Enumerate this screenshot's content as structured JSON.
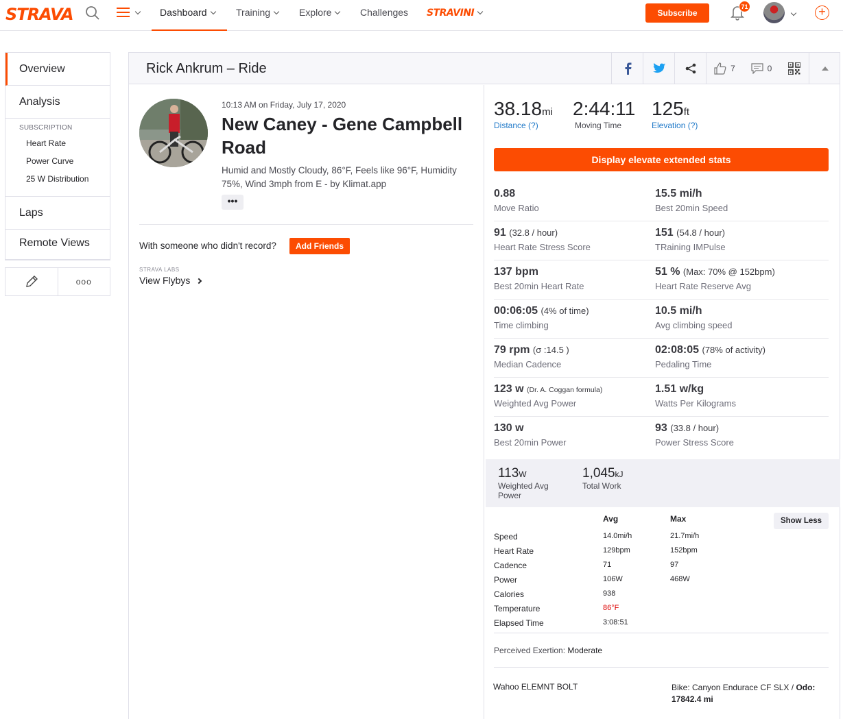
{
  "nav": {
    "logo": "STRAVA",
    "dashboard": "Dashboard",
    "training": "Training",
    "explore": "Explore",
    "challenges": "Challenges",
    "stravini": "STRAVINI",
    "subscribe": "Subscribe",
    "notifications": "71",
    "accent": "#fc4c02"
  },
  "sidebar": {
    "overview": "Overview",
    "analysis": "Analysis",
    "subscription_header": "SUBSCRIPTION",
    "sub_items": [
      "Heart Rate",
      "Power Curve",
      "25 W Distribution"
    ],
    "laps": "Laps",
    "remote_views": "Remote Views",
    "more": "ooo"
  },
  "header": {
    "title": "Rick Ankrum – Ride",
    "kudos": "7",
    "comments": "0"
  },
  "activity": {
    "date": "10:13 AM on Friday, July 17, 2020",
    "name": "New Caney - Gene Campbell Road",
    "description": "Humid and Mostly Cloudy, 86°F, Feels like 96°F, Humidity 75%, Wind 3mph from E - by Klimat.app",
    "more": "•••",
    "with_someone": "With someone who didn't record?",
    "add_friends": "Add Friends",
    "labs": "STRAVA LABS",
    "flybys": "View Flybys"
  },
  "big_stats": {
    "distance_val": "38.18",
    "distance_unit": "mi",
    "distance_lbl": "Distance (?)",
    "time_val": "2:44:11",
    "time_lbl": "Moving Time",
    "elev_val": "125",
    "elev_unit": "ft",
    "elev_lbl": "Elevation (?)"
  },
  "elevate_btn": "Display elevate extended stats",
  "extended": [
    [
      {
        "val": "0.88",
        "extra": "",
        "lbl": "Move Ratio"
      },
      {
        "val": "15.5 mi/h",
        "extra": "",
        "lbl": "Best 20min Speed"
      }
    ],
    [
      {
        "val": "91",
        "extra": "(32.8 / hour)",
        "lbl": "Heart Rate Stress Score"
      },
      {
        "val": "151",
        "extra": "(54.8 / hour)",
        "lbl": "TRaining IMPulse"
      }
    ],
    [
      {
        "val": "137 bpm",
        "extra": "",
        "lbl": "Best 20min Heart Rate"
      },
      {
        "val": "51 %",
        "extra": "(Max: 70% @ 152bpm)",
        "lbl": "Heart Rate Reserve Avg"
      }
    ],
    [
      {
        "val": "00:06:05",
        "extra": "(4% of time)",
        "lbl": "Time climbing"
      },
      {
        "val": "10.5 mi/h",
        "extra": "",
        "lbl": "Avg climbing speed"
      }
    ],
    [
      {
        "val": "79 rpm",
        "extra": "(σ :14.5 )",
        "lbl": "Median Cadence"
      },
      {
        "val": "02:08:05",
        "extra": "(78% of activity)",
        "lbl": "Pedaling Time"
      }
    ],
    [
      {
        "val": "123 w",
        "extra": "(Dr. A. Coggan formula)",
        "lbl": "Weighted Avg Power"
      },
      {
        "val": "1.51 w/kg",
        "extra": "",
        "lbl": "Watts Per Kilograms"
      }
    ],
    [
      {
        "val": "130 w",
        "extra": "",
        "lbl": "Best 20min Power"
      },
      {
        "val": "93",
        "extra": "(33.8 / hour)",
        "lbl": "Power Stress Score"
      }
    ]
  ],
  "power_box": {
    "wap_val": "113",
    "wap_unit": "W",
    "wap_lbl": "Weighted Avg Power",
    "work_val": "1,045",
    "work_unit": "kJ",
    "work_lbl": "Total Work"
  },
  "table": {
    "avg": "Avg",
    "max": "Max",
    "show_less": "Show Less",
    "rows": [
      [
        "Speed",
        "14.0mi/h",
        "21.7mi/h"
      ],
      [
        "Heart Rate",
        "129bpm",
        "152bpm"
      ],
      [
        "Cadence",
        "71",
        "97"
      ],
      [
        "Power",
        "106W",
        "468W"
      ],
      [
        "Calories",
        "938",
        ""
      ],
      [
        "Temperature",
        "86°F",
        ""
      ],
      [
        "Elapsed Time",
        "3:08:51",
        ""
      ]
    ]
  },
  "exertion_lbl": "Perceived Exertion:",
  "exertion_val": "Moderate",
  "device": "Wahoo ELEMNT BOLT",
  "bike": "Bike: Canyon Endurace CF SLX /",
  "odo": "Odo: 17842.4 mi"
}
